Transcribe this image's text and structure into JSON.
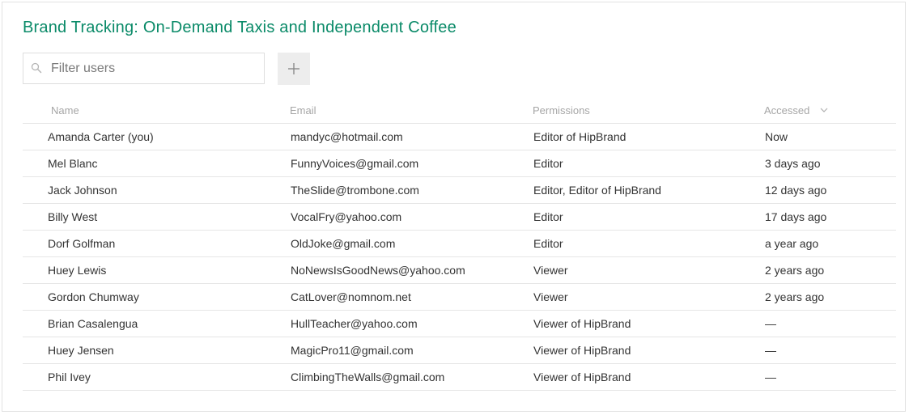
{
  "header": {
    "title": "Brand Tracking: On-Demand Taxis and Independent Coffee"
  },
  "filter": {
    "placeholder": "Filter users",
    "icon": "search-icon"
  },
  "add_button": {
    "icon": "plus-icon"
  },
  "colors": {
    "title": "#0a8a68",
    "header_text": "#a6a6a6",
    "row_border": "#e6e6e6",
    "add_button_bg": "#ededed"
  },
  "table": {
    "columns": [
      "Name",
      "Email",
      "Permissions",
      "Accessed"
    ],
    "sorted_column": "Accessed",
    "rows": [
      {
        "name": "Amanda Carter (you)",
        "email": "mandyc@hotmail.com",
        "permissions": "Editor of HipBrand",
        "accessed": "Now"
      },
      {
        "name": "Mel Blanc",
        "email": "FunnyVoices@gmail.com",
        "permissions": "Editor",
        "accessed": "3 days ago"
      },
      {
        "name": "Jack Johnson",
        "email": "TheSlide@trombone.com",
        "permissions": "Editor, Editor of HipBrand",
        "accessed": "12 days ago"
      },
      {
        "name": "Billy West",
        "email": "VocalFry@yahoo.com",
        "permissions": "Editor",
        "accessed": "17 days ago"
      },
      {
        "name": "Dorf Golfman",
        "email": "OldJoke@gmail.com",
        "permissions": "Editor",
        "accessed": "a year ago"
      },
      {
        "name": "Huey Lewis",
        "email": "NoNewsIsGoodNews@yahoo.com",
        "permissions": "Viewer",
        "accessed": "2 years ago"
      },
      {
        "name": "Gordon Chumway",
        "email": "CatLover@nomnom.net",
        "permissions": "Viewer",
        "accessed": "2 years ago"
      },
      {
        "name": "Brian Casalengua",
        "email": "HullTeacher@yahoo.com",
        "permissions": "Viewer of HipBrand",
        "accessed": "—"
      },
      {
        "name": "Huey Jensen",
        "email": "MagicPro11@gmail.com",
        "permissions": "Viewer of HipBrand",
        "accessed": "—"
      },
      {
        "name": "Phil Ivey",
        "email": "ClimbingTheWalls@gmail.com",
        "permissions": "Viewer of HipBrand",
        "accessed": "—"
      }
    ]
  }
}
